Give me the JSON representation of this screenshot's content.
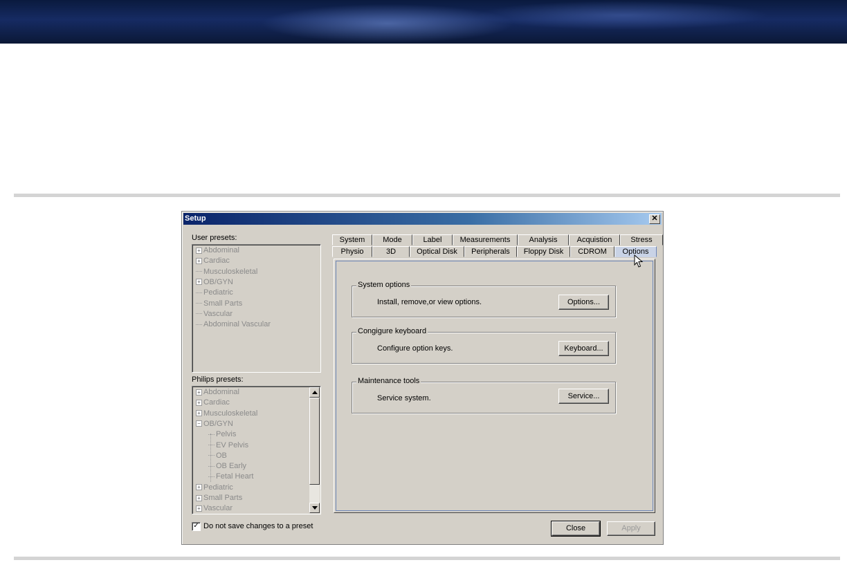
{
  "dialog": {
    "title": "Setup",
    "close_glyph": "✕"
  },
  "user_presets": {
    "label": "User presets:",
    "items": [
      {
        "label": "Abdominal",
        "expander": "+"
      },
      {
        "label": "Cardiac",
        "expander": "+"
      },
      {
        "label": "Musculoskeletal",
        "expander": ""
      },
      {
        "label": "OB/GYN",
        "expander": "+"
      },
      {
        "label": "Pediatric",
        "expander": ""
      },
      {
        "label": "Small Parts",
        "expander": ""
      },
      {
        "label": "Vascular",
        "expander": ""
      },
      {
        "label": "Abdominal Vascular",
        "expander": ""
      }
    ]
  },
  "philips_presets": {
    "label": "Philips presets:",
    "items": [
      {
        "label": "Abdominal",
        "expander": "+"
      },
      {
        "label": "Cardiac",
        "expander": "+"
      },
      {
        "label": "Musculoskeletal",
        "expander": "+"
      },
      {
        "label": "OB/GYN",
        "expander": "−"
      },
      {
        "label": "Pelvis",
        "expander": ""
      },
      {
        "label": "EV Pelvis",
        "expander": ""
      },
      {
        "label": "OB",
        "expander": ""
      },
      {
        "label": "OB Early",
        "expander": ""
      },
      {
        "label": "Fetal Heart",
        "expander": ""
      },
      {
        "label": "Pediatric",
        "expander": "+"
      },
      {
        "label": "Small Parts",
        "expander": "+"
      },
      {
        "label": "Vascular",
        "expander": "+"
      }
    ]
  },
  "tabs_row1": [
    "System",
    "Mode",
    "Label",
    "Measurements",
    "Analysis",
    "Acquistion",
    "Stress"
  ],
  "tabs_row2": [
    "Physio",
    "3D",
    "Optical Disk",
    "Peripherals",
    "Floppy Disk",
    "CDROM",
    "Options"
  ],
  "active_tab": "Options",
  "groups": [
    {
      "title": "System options",
      "description": "Install, remove,or view options.",
      "button": "Options..."
    },
    {
      "title": "Congigure keyboard",
      "description": "Configure option keys.",
      "button": "Keyboard..."
    },
    {
      "title": "Maintenance tools",
      "description": "Service system.",
      "button": "Service..."
    }
  ],
  "footer": {
    "checkbox_label": "Do not save changes to a preset",
    "checkbox_checked": true,
    "check_glyph": "✓",
    "close_button": "Close",
    "apply_button": "Apply"
  },
  "scroll": {
    "up_glyph": "▲",
    "down_glyph": "▼"
  }
}
